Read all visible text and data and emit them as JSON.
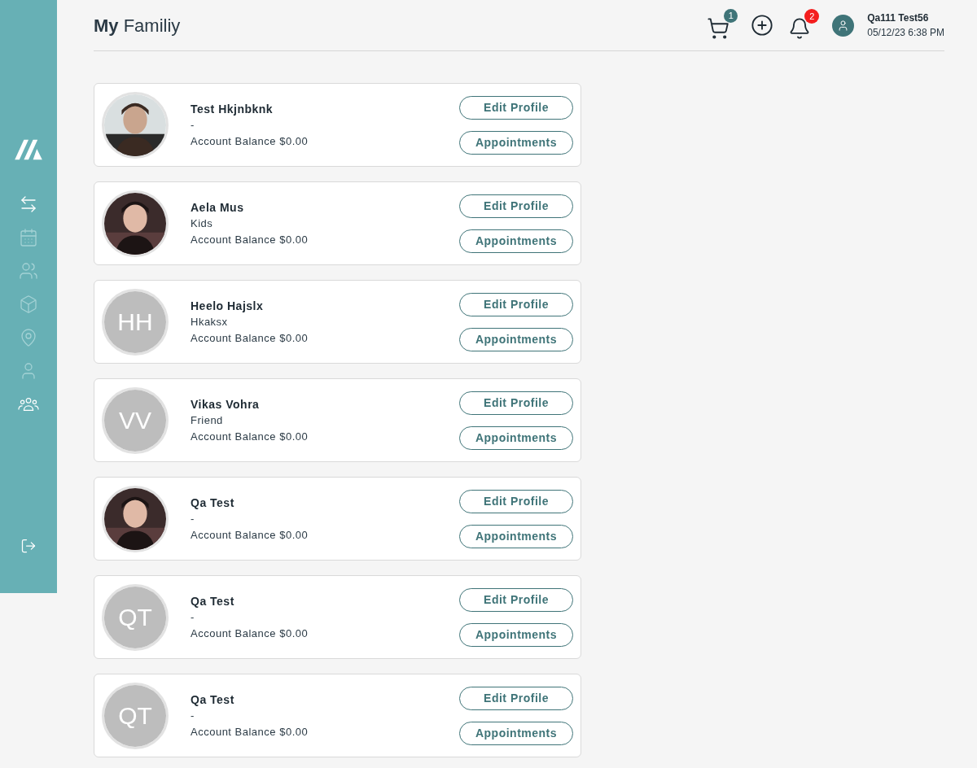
{
  "header": {
    "title": "**My** Familiy",
    "cart_count": "1",
    "notification_count": "2",
    "user_name": "Qa111 Test56",
    "datetime": "05/12/23 6:38 PM"
  },
  "sidebar": {
    "items": [
      {
        "kind": "calendar",
        "selected": false
      },
      {
        "kind": "people",
        "selected": false
      },
      {
        "kind": "box",
        "selected": false
      },
      {
        "kind": "pin",
        "selected": false
      },
      {
        "kind": "user",
        "selected": false
      },
      {
        "kind": "family",
        "selected": true
      }
    ]
  },
  "members": [
    {
      "name": "Test Hkjnbknk",
      "relation": "-",
      "balance": "Account Balance $0.00",
      "buttons": [
        "Edit Profile",
        "Appointments"
      ]
    },
    {
      "name": "Aela Mus",
      "relation": "Kids",
      "balance": "Account Balance $0.00",
      "buttons": [
        "Edit Profile",
        "Appointments"
      ]
    },
    {
      "name": "Heelo Hajslx",
      "relation": "Hkaksx",
      "balance": "Account Balance $0.00",
      "avatar": {
        "kind": "initials",
        "initials": "HH"
      },
      "buttons": [
        "Edit Profile",
        "Appointments"
      ]
    },
    {
      "name": "Vikas Vohra",
      "relation": "Friend",
      "balance": "Account Balance $0.00",
      "avatar": {
        "kind": "initials",
        "initials": "VV"
      },
      "buttons": [
        "Edit Profile",
        "Appointments"
      ]
    },
    {
      "name": "Qa Test",
      "relation": "-",
      "balance": "Account Balance $0.00",
      "buttons": [
        "Edit Profile",
        "Appointments"
      ]
    },
    {
      "name": "Qa Test",
      "relation": "-",
      "balance": "Account Balance $0.00",
      "avatar": {
        "kind": "initials",
        "initials": "QT"
      },
      "buttons": [
        "Edit Profile",
        "Appointments"
      ]
    },
    {
      "name": "Qa Test",
      "relation": "-",
      "balance": "Account Balance $0.00",
      "avatar": {
        "kind": "initials",
        "initials": "QT"
      },
      "buttons": [
        "Edit Profile",
        "Appointments"
      ]
    }
  ]
}
